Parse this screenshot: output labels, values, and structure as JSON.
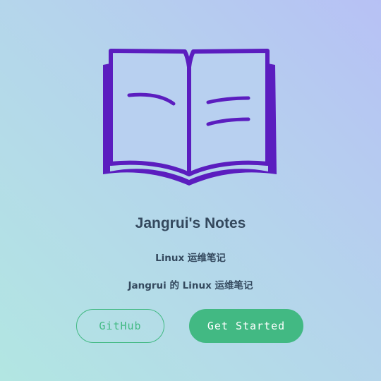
{
  "cover": {
    "logo_icon": "open-book-icon",
    "title": "Jangrui's Notes",
    "subtitle": "Linux 运维笔记",
    "description": "Jangrui 的 Linux 运维笔记",
    "buttons": {
      "github_label": "GitHub",
      "get_started_label": "Get Started"
    }
  },
  "colors": {
    "accent": "#42b983",
    "text": "#34495e",
    "logo": "#5b1dbf",
    "background_start": "#b7c1f5",
    "background_end": "#b2e6e2"
  }
}
